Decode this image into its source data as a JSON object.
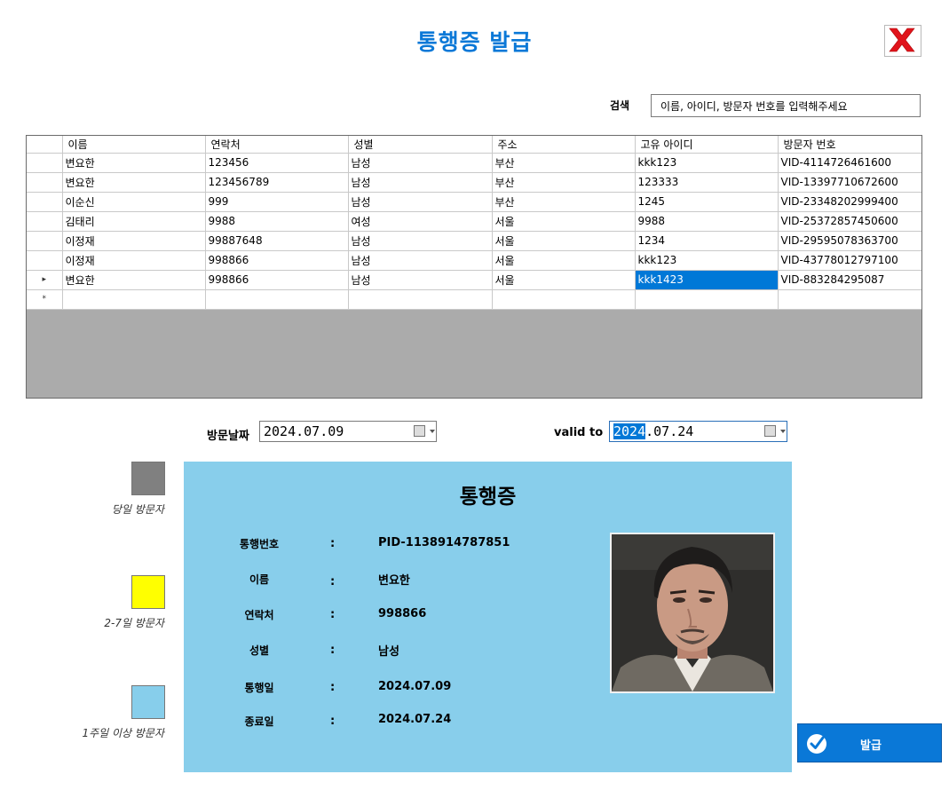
{
  "title": "통행증 발급",
  "search": {
    "label": "검색",
    "placeholder": "이름, 아이디, 방문자 번호를 입력해주세요"
  },
  "grid": {
    "columns": [
      "이름",
      "연락처",
      "성별",
      "주소",
      "고유 아이디",
      "방문자 번호"
    ],
    "rows": [
      [
        "변요한",
        "123456",
        "남성",
        "부산",
        "kkk123",
        "VID-4114726461600"
      ],
      [
        "변요한",
        "123456789",
        "남성",
        "부산",
        "123333",
        "VID-13397710672600"
      ],
      [
        "이순신",
        "999",
        "남성",
        "부산",
        "1245",
        "VID-23348202999400"
      ],
      [
        "김태리",
        "9988",
        "여성",
        "서울",
        "9988",
        "VID-25372857450600"
      ],
      [
        "이정재",
        "99887648",
        "남성",
        "서울",
        "1234",
        "VID-29595078363700"
      ],
      [
        "이정재",
        "998866",
        "남성",
        "서울",
        "kkk123",
        "VID-43778012797100"
      ],
      [
        "변요한",
        "998866",
        "남성",
        "서울",
        "kkk1423",
        "VID-883284295087"
      ]
    ],
    "current_row_marker": "▸",
    "new_row_marker": "*"
  },
  "visit_date": {
    "label": "방문날짜",
    "value": "2024.07.09"
  },
  "valid_to": {
    "label": "valid to",
    "value_year": "2024",
    "value_rest": ".07.24"
  },
  "legend": [
    {
      "label": "당일 방문자",
      "color": "#808080"
    },
    {
      "label": "2-7일 방문자",
      "color": "#ffff00"
    },
    {
      "label": "1주일 이상 방문자",
      "color": "#87ceeb"
    }
  ],
  "pass": {
    "title": "통행증",
    "colon": ":",
    "fields": [
      {
        "label": "통행번호",
        "value": "PID-1138914787851"
      },
      {
        "label": "이름",
        "value": "변요한"
      },
      {
        "label": "연락처",
        "value": "998866"
      },
      {
        "label": "성별",
        "value": "남성"
      },
      {
        "label": "통행일",
        "value": "2024.07.09"
      },
      {
        "label": "종료일",
        "value": "2024.07.24"
      }
    ],
    "background": "#88ceeb"
  },
  "issue_button": {
    "label": "발급"
  },
  "colors": {
    "accent": "#0a78d7",
    "close_red": "#e0141c",
    "selection": "#0078d7"
  }
}
